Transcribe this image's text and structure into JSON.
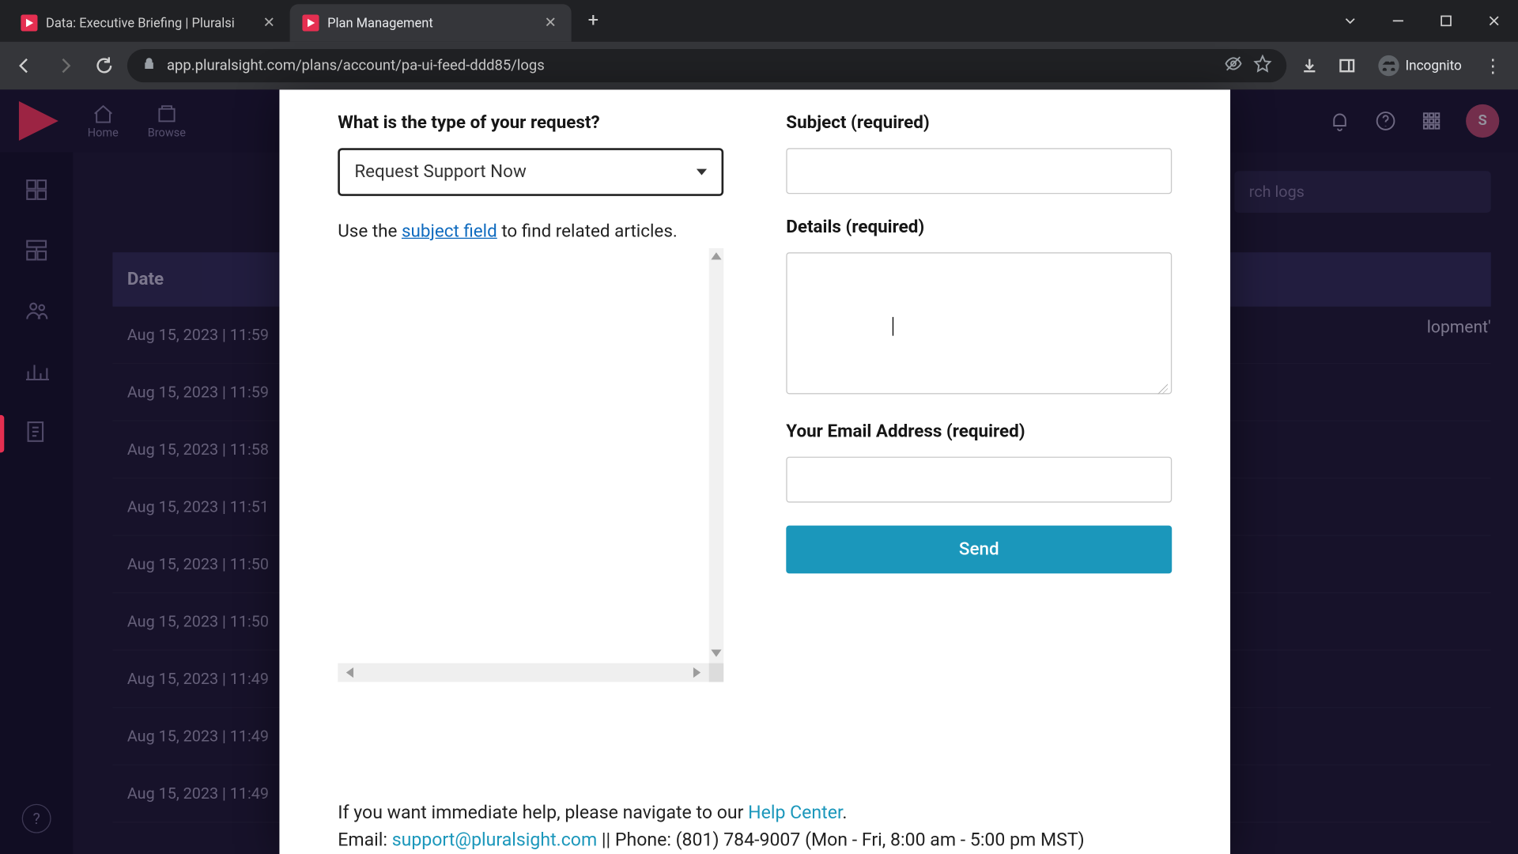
{
  "browser": {
    "tabs": [
      {
        "title": "Data: Executive Briefing | Pluralsi"
      },
      {
        "title": "Plan Management"
      }
    ],
    "url": "app.pluralsight.com/plans/account/pa-ui-feed-ddd85/logs",
    "incognito_label": "Incognito"
  },
  "app": {
    "nav": {
      "home": "Home",
      "browse": "Browse"
    },
    "avatar_initial": "S",
    "search_placeholder": "rch logs",
    "table_header": "Date",
    "rows": [
      "Aug 15, 2023 | 11:59",
      "Aug 15, 2023 | 11:59",
      "Aug 15, 2023 | 11:58",
      "Aug 15, 2023 | 11:51",
      "Aug 15, 2023 | 11:50",
      "Aug 15, 2023 | 11:50",
      "Aug 15, 2023 | 11:49",
      "Aug 15, 2023 | 11:49",
      "Aug 15, 2023 | 11:49"
    ],
    "row_tail": "lopment'"
  },
  "form": {
    "type_label": "What is the type of your request?",
    "type_value": "Request Support Now",
    "hint_pre": "Use the ",
    "hint_link": "subject field",
    "hint_post": " to find related articles.",
    "subject_label": "Subject (required)",
    "details_label": "Details (required)",
    "email_label": "Your Email Address (required)",
    "send_label": "Send"
  },
  "footer": {
    "line1_pre": "If you want immediate help, please navigate to our ",
    "line1_link": "Help Center",
    "line1_post": ".",
    "line2_pre": "Email: ",
    "line2_email": "support@pluralsight.com",
    "line2_post": " || Phone: (801) 784-9007 (Mon - Fri, 8:00 am - 5:00 pm MST)"
  }
}
